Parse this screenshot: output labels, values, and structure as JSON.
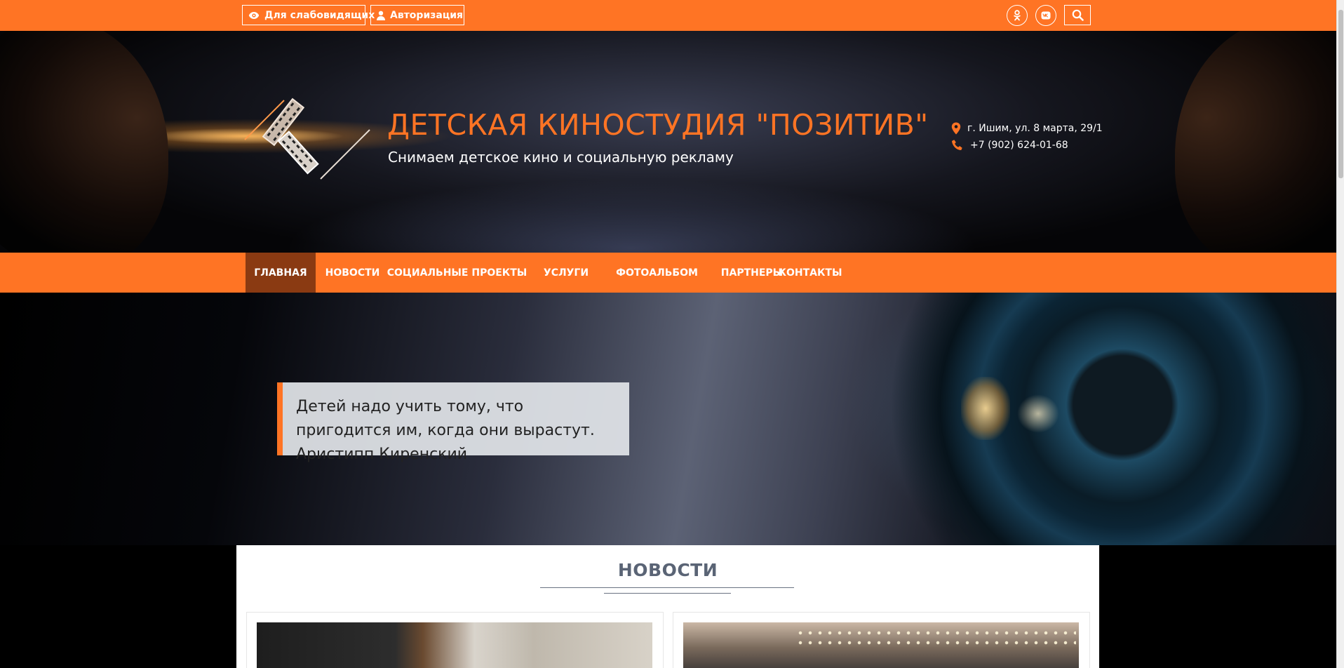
{
  "topbar": {
    "accessibility_label": "Для слабовидящих",
    "login_label": "Авторизация"
  },
  "header": {
    "title": "ДЕТСКАЯ КИНОСТУДИЯ \"ПОЗИТИВ\"",
    "slogan": "Снимаем детское кино и социальную рекламу",
    "address": "г. Ишим, ул. 8 марта, 29/1",
    "phone": "+7 (902) 624-01-68"
  },
  "nav": {
    "items": [
      {
        "label": "ГЛАВНАЯ",
        "active": true
      },
      {
        "label": "НОВОСТИ"
      },
      {
        "label": "СОЦИАЛЬНЫЕ ПРОЕКТЫ"
      },
      {
        "label": "УСЛУГИ"
      },
      {
        "label": "ФОТОАЛЬБОМ"
      },
      {
        "label": "ПАРТНЕРЫ"
      },
      {
        "label": "КОНТАКТЫ"
      }
    ]
  },
  "hero": {
    "quote": "Детей надо учить тому, что пригодится им, когда они вырастут. Аристипп Киренский"
  },
  "news": {
    "heading": "НОВОСТИ"
  },
  "colors": {
    "accent": "#ff7424",
    "nav_active": "#8a3a12",
    "heading": "#5a6475"
  },
  "icons": {
    "accessibility": "eye-icon",
    "login": "user-icon",
    "odnoklassniki": "odnoklassniki-icon",
    "vk": "vk-icon",
    "search": "search-icon",
    "address": "map-pin-icon",
    "phone": "phone-icon",
    "logo": "film-strip-logo"
  }
}
